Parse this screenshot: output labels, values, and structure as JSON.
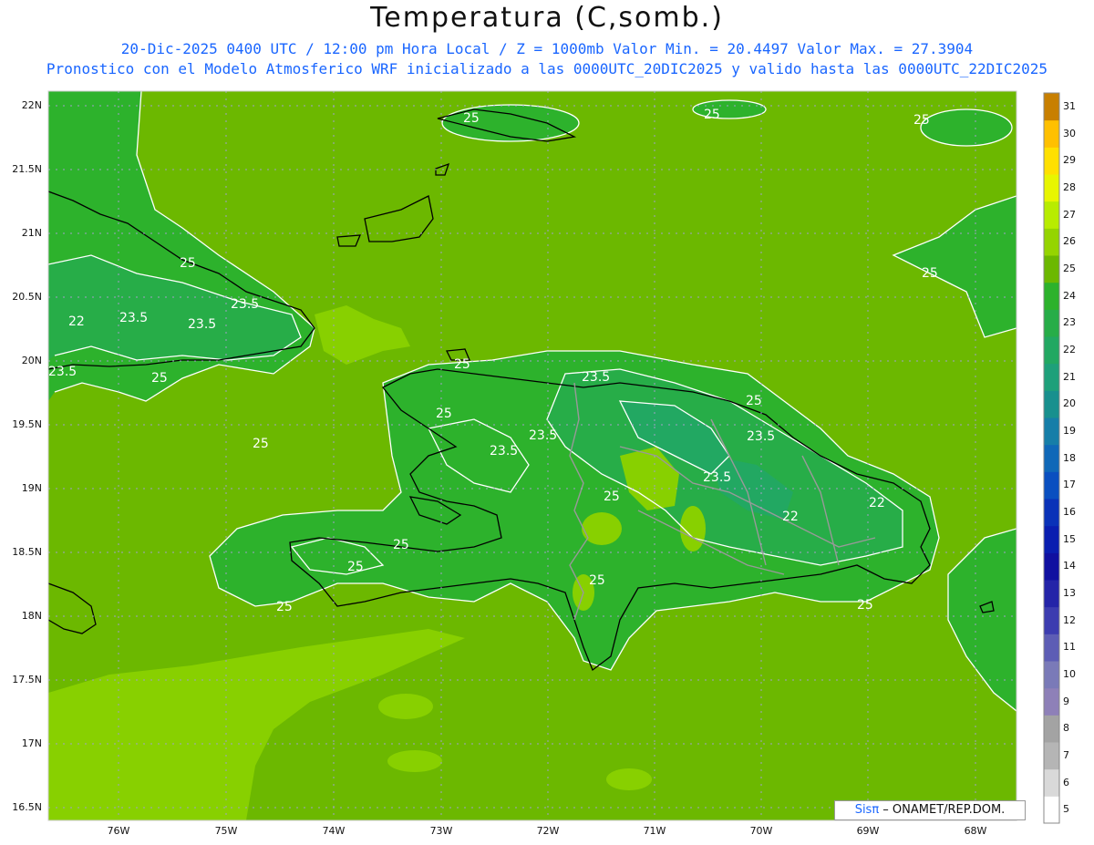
{
  "title": "Temperatura (C,somb.)",
  "subtitle_line1": "20-Dic-2025 0400 UTC / 12:00 pm Hora Local / Z = 1000mb  Valor Min. = 20.4497  Valor Max. = 27.3904",
  "subtitle_line2": "Pronostico con el Modelo Atmosferico WRF inicializado a las 0000UTC_20DIC2025 y valido hasta las  0000UTC_22DIC2025",
  "lat_labels": [
    "22N",
    "21.5N",
    "21N",
    "20.5N",
    "20N",
    "19.5N",
    "19N",
    "18.5N",
    "18N",
    "17.5N",
    "17N",
    "16.5N"
  ],
  "lon_labels": [
    "76W",
    "75W",
    "74W",
    "73W",
    "72W",
    "71W",
    "70W",
    "69W",
    "68W"
  ],
  "colorbar": {
    "levels": [
      "5",
      "6",
      "7",
      "8",
      "9",
      "10",
      "11",
      "12",
      "13",
      "14",
      "15",
      "16",
      "17",
      "18",
      "19",
      "20",
      "21",
      "22",
      "23",
      "24",
      "25",
      "26",
      "27",
      "28",
      "29",
      "30",
      "31"
    ],
    "colors": [
      "#ffffff",
      "#d9d9d9",
      "#b5b5b5",
      "#a3a3a3",
      "#8e80b8",
      "#7a7ab8",
      "#5d5db5",
      "#3c3cb0",
      "#2424a8",
      "#1010a0",
      "#0a1eb0",
      "#0a32b8",
      "#0a4fc0",
      "#0f68b8",
      "#167ea8",
      "#18908e",
      "#1ea07a",
      "#22a862",
      "#27ad48",
      "#2db22c",
      "#6cb800",
      "#95d400",
      "#b8ec00",
      "#e8f500",
      "#ffe000",
      "#ffc000",
      "#c87f00"
    ]
  },
  "contour_labels": [
    "25",
    "25",
    "25",
    "25",
    "25",
    "25",
    "25",
    "25",
    "25",
    "25",
    "25",
    "25",
    "25",
    "25",
    "25",
    "25",
    "23.5",
    "23.5",
    "23.5",
    "23.5",
    "23.5",
    "23.5",
    "23.5",
    "23.5",
    "23.5",
    "22",
    "22",
    "22"
  ],
  "colors": {
    "base_green": "#6cb800",
    "mid_green": "#2db22c",
    "dark_green": "#27ad48",
    "light_green": "#88d000",
    "coast": "#000000",
    "contour": "#ffffff",
    "border": "#999999"
  },
  "credit": {
    "brand": "Sisπ",
    "text": " – ONAMET/REP.DOM."
  }
}
